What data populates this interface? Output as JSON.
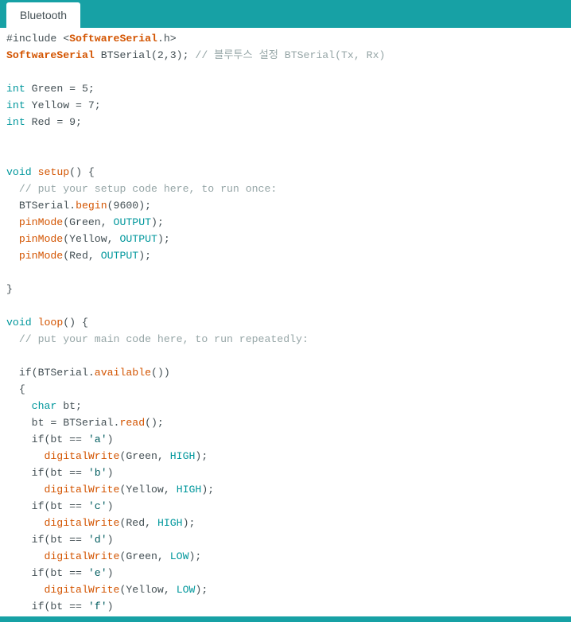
{
  "window": {
    "tabs": [
      {
        "label": "Bluetooth",
        "active": true
      }
    ]
  },
  "colors": {
    "teal_bar": "#17a1a5",
    "keyword_type": "#00979c",
    "function": "#d35400",
    "comment": "#95a5a6",
    "text": "#434f54"
  },
  "editor": {
    "lines": [
      [
        {
          "t": "#include <",
          "c": "pre"
        },
        {
          "t": "SoftwareSerial",
          "c": "func bold"
        },
        {
          "t": ".h>",
          "c": "pre"
        }
      ],
      [
        {
          "t": "SoftwareSerial",
          "c": "func bold"
        },
        {
          "t": " BTSerial(2,3); ",
          "c": "default"
        },
        {
          "t": "// 블루투스 설정 BTSerial(Tx, Rx)",
          "c": "comment"
        }
      ],
      [],
      [
        {
          "t": "int",
          "c": "type"
        },
        {
          "t": " Green = 5;",
          "c": "default"
        }
      ],
      [
        {
          "t": "int",
          "c": "type"
        },
        {
          "t": " Yellow = 7;",
          "c": "default"
        }
      ],
      [
        {
          "t": "int",
          "c": "type"
        },
        {
          "t": " Red = 9;",
          "c": "default"
        }
      ],
      [],
      [],
      [
        {
          "t": "void",
          "c": "type"
        },
        {
          "t": " ",
          "c": "default"
        },
        {
          "t": "setup",
          "c": "func"
        },
        {
          "t": "() {",
          "c": "default"
        }
      ],
      [
        {
          "t": "  // put your setup code here, to run once:",
          "c": "comment"
        }
      ],
      [
        {
          "t": "  BTSerial.",
          "c": "default"
        },
        {
          "t": "begin",
          "c": "func"
        },
        {
          "t": "(9600);",
          "c": "default"
        }
      ],
      [
        {
          "t": "  ",
          "c": "default"
        },
        {
          "t": "pinMode",
          "c": "func"
        },
        {
          "t": "(Green, ",
          "c": "default"
        },
        {
          "t": "OUTPUT",
          "c": "const"
        },
        {
          "t": ");",
          "c": "default"
        }
      ],
      [
        {
          "t": "  ",
          "c": "default"
        },
        {
          "t": "pinMode",
          "c": "func"
        },
        {
          "t": "(Yellow, ",
          "c": "default"
        },
        {
          "t": "OUTPUT",
          "c": "const"
        },
        {
          "t": ");",
          "c": "default"
        }
      ],
      [
        {
          "t": "  ",
          "c": "default"
        },
        {
          "t": "pinMode",
          "c": "func"
        },
        {
          "t": "(Red, ",
          "c": "default"
        },
        {
          "t": "OUTPUT",
          "c": "const"
        },
        {
          "t": ");",
          "c": "default"
        }
      ],
      [],
      [
        {
          "t": "}",
          "c": "default"
        }
      ],
      [],
      [
        {
          "t": "void",
          "c": "type"
        },
        {
          "t": " ",
          "c": "default"
        },
        {
          "t": "loop",
          "c": "func"
        },
        {
          "t": "() {",
          "c": "default"
        }
      ],
      [
        {
          "t": "  // put your main code here, to run repeatedly:",
          "c": "comment"
        }
      ],
      [],
      [
        {
          "t": "  if",
          "c": "default"
        },
        {
          "t": "(BTSerial.",
          "c": "default"
        },
        {
          "t": "available",
          "c": "func"
        },
        {
          "t": "())",
          "c": "default"
        }
      ],
      [
        {
          "t": "  {",
          "c": "default"
        }
      ],
      [
        {
          "t": "    ",
          "c": "default"
        },
        {
          "t": "char",
          "c": "type"
        },
        {
          "t": " bt;",
          "c": "default"
        }
      ],
      [
        {
          "t": "    bt = BTSerial.",
          "c": "default"
        },
        {
          "t": "read",
          "c": "func"
        },
        {
          "t": "();",
          "c": "default"
        }
      ],
      [
        {
          "t": "    if(bt == ",
          "c": "default"
        },
        {
          "t": "'a'",
          "c": "string"
        },
        {
          "t": ")",
          "c": "default"
        }
      ],
      [
        {
          "t": "      ",
          "c": "default"
        },
        {
          "t": "digitalWrite",
          "c": "func"
        },
        {
          "t": "(Green, ",
          "c": "default"
        },
        {
          "t": "HIGH",
          "c": "const"
        },
        {
          "t": ");",
          "c": "default"
        }
      ],
      [
        {
          "t": "    if(bt == ",
          "c": "default"
        },
        {
          "t": "'b'",
          "c": "string"
        },
        {
          "t": ")",
          "c": "default"
        }
      ],
      [
        {
          "t": "      ",
          "c": "default"
        },
        {
          "t": "digitalWrite",
          "c": "func"
        },
        {
          "t": "(Yellow, ",
          "c": "default"
        },
        {
          "t": "HIGH",
          "c": "const"
        },
        {
          "t": ");",
          "c": "default"
        }
      ],
      [
        {
          "t": "    if(bt == ",
          "c": "default"
        },
        {
          "t": "'c'",
          "c": "string"
        },
        {
          "t": ")",
          "c": "default"
        }
      ],
      [
        {
          "t": "      ",
          "c": "default"
        },
        {
          "t": "digitalWrite",
          "c": "func"
        },
        {
          "t": "(Red, ",
          "c": "default"
        },
        {
          "t": "HIGH",
          "c": "const"
        },
        {
          "t": ");",
          "c": "default"
        }
      ],
      [
        {
          "t": "    if(bt == ",
          "c": "default"
        },
        {
          "t": "'d'",
          "c": "string"
        },
        {
          "t": ")",
          "c": "default"
        }
      ],
      [
        {
          "t": "      ",
          "c": "default"
        },
        {
          "t": "digitalWrite",
          "c": "func"
        },
        {
          "t": "(Green, ",
          "c": "default"
        },
        {
          "t": "LOW",
          "c": "const"
        },
        {
          "t": ");",
          "c": "default"
        }
      ],
      [
        {
          "t": "    if(bt == ",
          "c": "default"
        },
        {
          "t": "'e'",
          "c": "string"
        },
        {
          "t": ")",
          "c": "default"
        }
      ],
      [
        {
          "t": "      ",
          "c": "default"
        },
        {
          "t": "digitalWrite",
          "c": "func"
        },
        {
          "t": "(Yellow, ",
          "c": "default"
        },
        {
          "t": "LOW",
          "c": "const"
        },
        {
          "t": ");",
          "c": "default"
        }
      ],
      [
        {
          "t": "    if(bt == ",
          "c": "default"
        },
        {
          "t": "'f'",
          "c": "string"
        },
        {
          "t": ")",
          "c": "default"
        }
      ]
    ]
  }
}
